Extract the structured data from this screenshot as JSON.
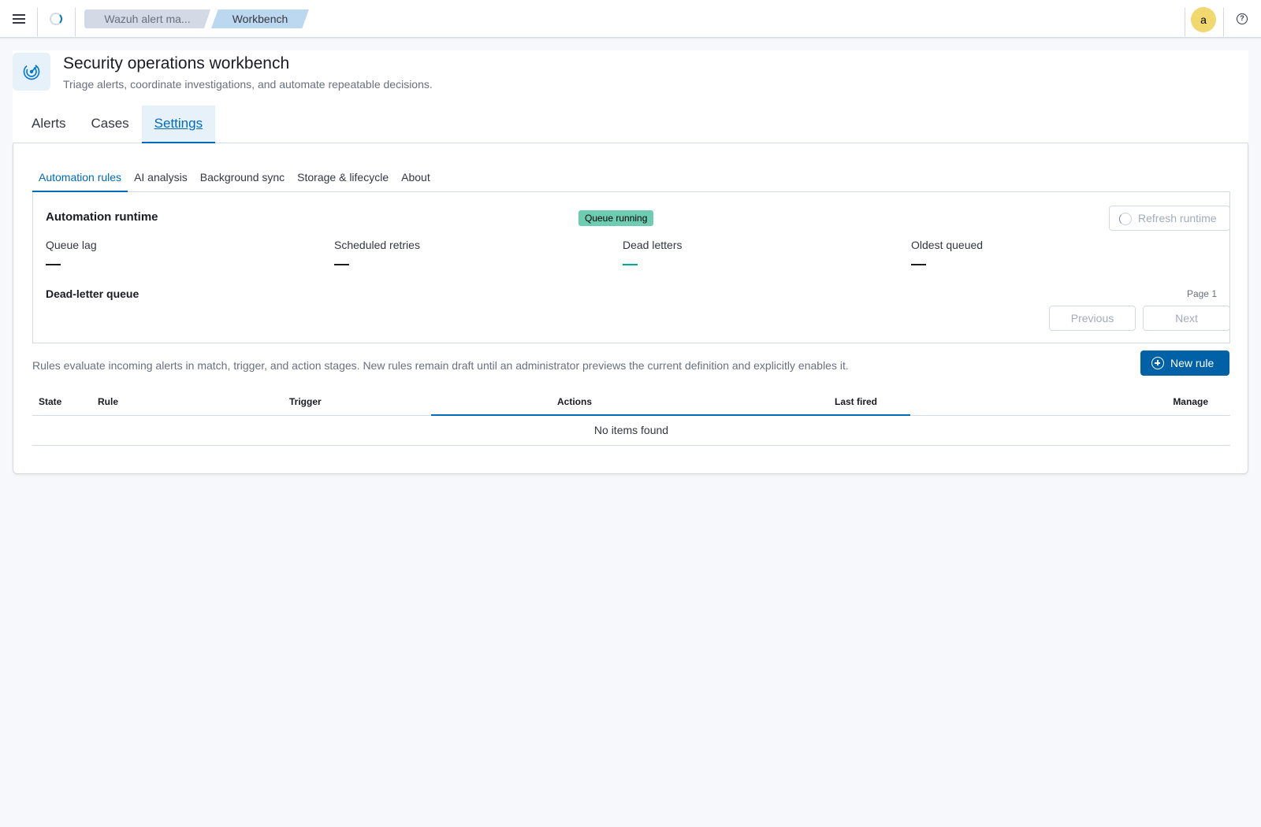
{
  "topbar": {
    "breadcrumbs": [
      "Wazuh alert ma...",
      "Workbench"
    ],
    "avatar_initial": "a",
    "help_glyph": "?",
    "icons": [
      "menu-icon",
      "loading-icon",
      "help-icon"
    ]
  },
  "header": {
    "title": "Security operations workbench",
    "subtitle": "Triage alerts, coordinate investigations, and automate repeatable decisions.",
    "tabs": [
      {
        "label": "Alerts",
        "active": false
      },
      {
        "label": "Cases",
        "active": false
      },
      {
        "label": "Settings",
        "active": true
      }
    ]
  },
  "settings": {
    "sub_tabs": [
      {
        "label": "Automation rules",
        "active": true
      },
      {
        "label": "AI analysis",
        "active": false
      },
      {
        "label": "Background sync",
        "active": false
      },
      {
        "label": "Storage & lifecycle",
        "active": false
      },
      {
        "label": "About",
        "active": false
      }
    ],
    "runtime": {
      "title": "Automation runtime",
      "status_badge": "Queue running",
      "refresh_label": "Refresh runtime",
      "stats": [
        {
          "label": "Queue lag",
          "value": "—"
        },
        {
          "label": "Scheduled retries",
          "value": "—"
        },
        {
          "label": "Dead letters",
          "value": "—"
        },
        {
          "label": "Oldest queued",
          "value": "—"
        }
      ],
      "dead_letter": {
        "title": "Dead-letter queue",
        "page_label": "Page 1",
        "previous_label": "Previous",
        "next_label": "Next"
      }
    },
    "rules": {
      "description": "Rules evaluate incoming alerts in match, trigger, and action stages. New rules remain draft until an administrator previews the current definition and explicitly enables it.",
      "new_rule_label": "New rule",
      "columns": [
        "State",
        "Rule",
        "Trigger",
        "Actions",
        "Last fired",
        "Manage"
      ],
      "empty_message": "No items found"
    }
  },
  "colors": {
    "accent": "#006bb8",
    "primary_button": "#0061a6",
    "badge_success": "#6dccb1",
    "avatar": "#f1d86f",
    "dead_letters_indicator": "#00a69b"
  }
}
